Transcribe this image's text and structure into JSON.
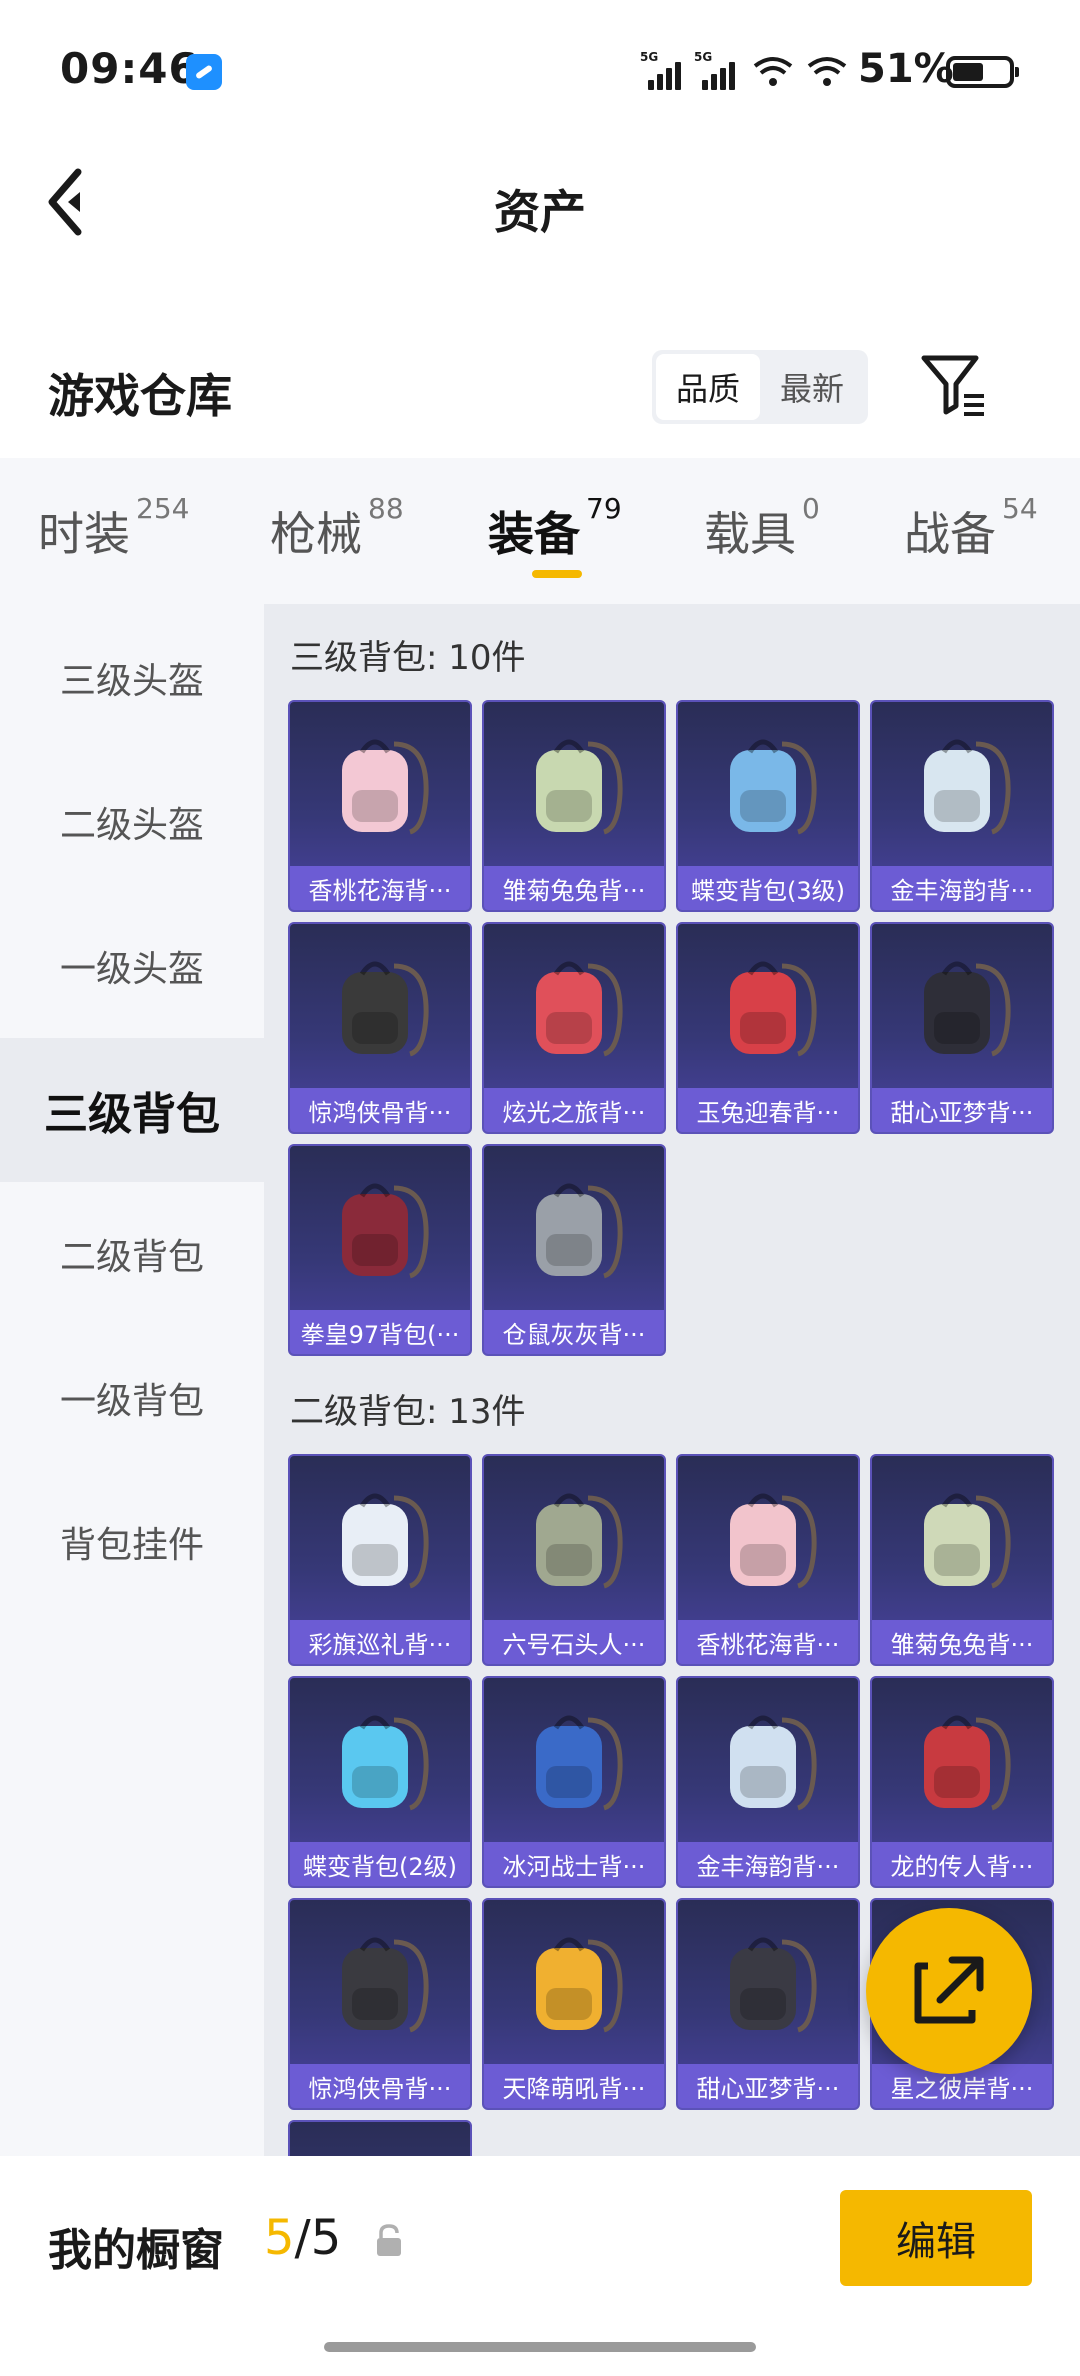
{
  "status": {
    "time": "09:46",
    "battery": "51%",
    "signal_1": "5G",
    "signal_2": "5G"
  },
  "header": {
    "title": "资产"
  },
  "section": {
    "title": "游戏仓库",
    "sort_options": [
      "品质",
      "最新"
    ]
  },
  "tabs": [
    {
      "label": "时装",
      "count": "254"
    },
    {
      "label": "枪械",
      "count": "88"
    },
    {
      "label": "装备",
      "count": "79"
    },
    {
      "label": "载具",
      "count": "0"
    },
    {
      "label": "战备",
      "count": "54"
    }
  ],
  "sidebar": [
    "三级头盔",
    "二级头盔",
    "一级头盔",
    "三级背包",
    "二级背包",
    "一级背包",
    "背包挂件"
  ],
  "groups": [
    {
      "title": "三级背包: 10件",
      "items": [
        "香桃花海背···",
        "雏菊兔兔背···",
        "蝶变背包(3级)",
        "金丰海韵背···",
        "惊鸿侠骨背···",
        "炫光之旅背···",
        "玉兔迎春背···",
        "甜心亚梦背···",
        "拳皇97背包(···",
        "仓鼠灰灰背···"
      ]
    },
    {
      "title": "二级背包: 13件",
      "items": [
        "彩旗巡礼背···",
        "六号石头人···",
        "香桃花海背···",
        "雏菊兔兔背···",
        "蝶变背包(2级)",
        "冰河战士背···",
        "金丰海韵背···",
        "龙的传人背···",
        "惊鸿侠骨背···",
        "天降萌吼背···",
        "甜心亚梦背···",
        "星之彼岸背···"
      ]
    }
  ],
  "item_colors": [
    "#f3c8d4",
    "#c8d8b0",
    "#7ab8e8",
    "#d8e6f0",
    "#3a3a3a",
    "#e0505a",
    "#d84048",
    "#2e2e38",
    "#8a2a3a",
    "#9aa0a8",
    "#e8eef6",
    "#a0a890",
    "#f2c4cc",
    "#cfd9b8",
    "#5ac8f0",
    "#3a6ac8",
    "#d0e0f0",
    "#c83a40",
    "#3a3a40",
    "#f0b030",
    "#3a3a44",
    "#c8a0e0"
  ],
  "footer": {
    "showcase_label": "我的橱窗",
    "showcase_current": "5",
    "showcase_total": "/5",
    "edit_label": "编辑"
  }
}
